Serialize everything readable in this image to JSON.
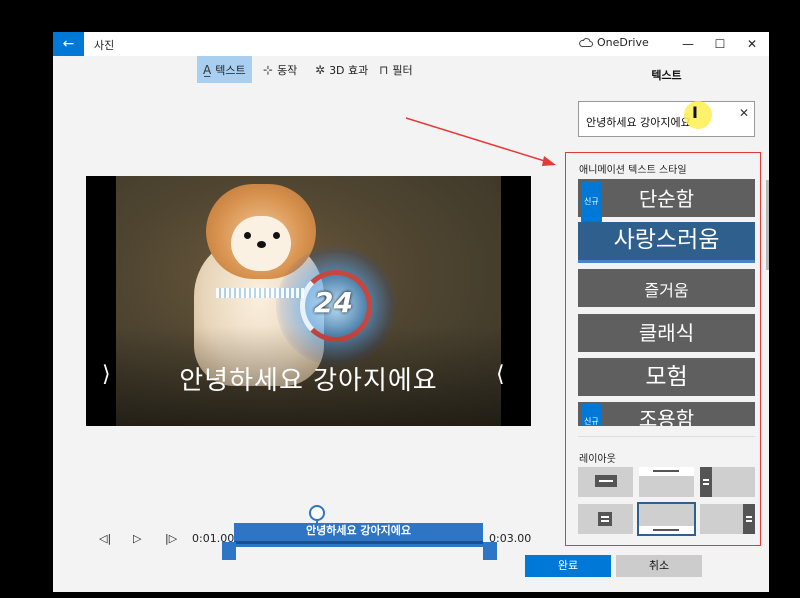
{
  "window": {
    "app_title": "사진",
    "onedrive_label": "OneDrive",
    "back_glyph": "←",
    "minimize_glyph": "—",
    "maximize_glyph": "☐",
    "close_glyph": "✕"
  },
  "toolbar": {
    "text_label": "텍스트",
    "motion_label": "동작",
    "effects_label": "3D 효과",
    "filters_label": "필터"
  },
  "preview": {
    "overlay_text": "안녕하세요 강아지에요",
    "counter": "24"
  },
  "timeline": {
    "start_time": "0:01.00",
    "end_time": "0:03.00",
    "clip_text": "안녕하세요 강아지에요"
  },
  "panel": {
    "title": "텍스트",
    "input_value": "안녕하세요 강아지에요",
    "animated_styles_label": "애니메이션 텍스트 스타일",
    "new_badge": "신규",
    "styles": [
      "단순함",
      "사랑스러움",
      "즐거움",
      "클래식",
      "모험",
      "조용함"
    ],
    "layout_label": "레이아웃",
    "done_label": "완료",
    "cancel_label": "취소"
  },
  "colors": {
    "accent": "#0078d7",
    "selected_style": "#2f5f8c",
    "style_card": "#5f5f5f",
    "annotation_red": "#e53935"
  }
}
